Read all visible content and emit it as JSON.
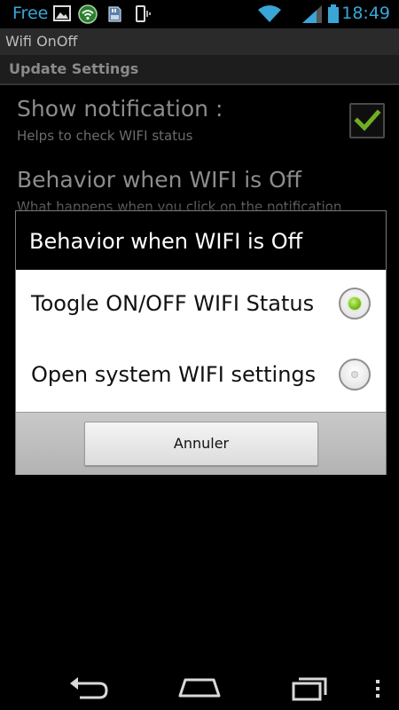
{
  "status_bar": {
    "carrier": "Free",
    "time": "18:49",
    "accent_color": "#3aa6d6",
    "icons": [
      "image-icon",
      "wifi-app-icon",
      "sd-card-icon",
      "vibrate-icon",
      "wifi-signal-icon",
      "cell-signal-icon",
      "battery-icon"
    ]
  },
  "app": {
    "title": "Wifi OnOff"
  },
  "settings": {
    "category": "Update Settings",
    "items": [
      {
        "title": "Show notification :",
        "summary": "Helps to check WIFI status",
        "checked": true
      },
      {
        "title": "Behavior when WIFI is Off",
        "summary": "What happens when you click on the notification"
      }
    ]
  },
  "dialog": {
    "title": "Behavior when WIFI is Off",
    "options": [
      {
        "label": "Toogle ON/OFF WIFI Status",
        "selected": true
      },
      {
        "label": "Open system WIFI settings",
        "selected": false
      }
    ],
    "cancel_label": "Annuler",
    "selected_color": "#7bc21e"
  },
  "nav_bar": {
    "icons": [
      "back-icon",
      "home-icon",
      "recent-apps-icon",
      "overflow-menu-icon"
    ]
  }
}
